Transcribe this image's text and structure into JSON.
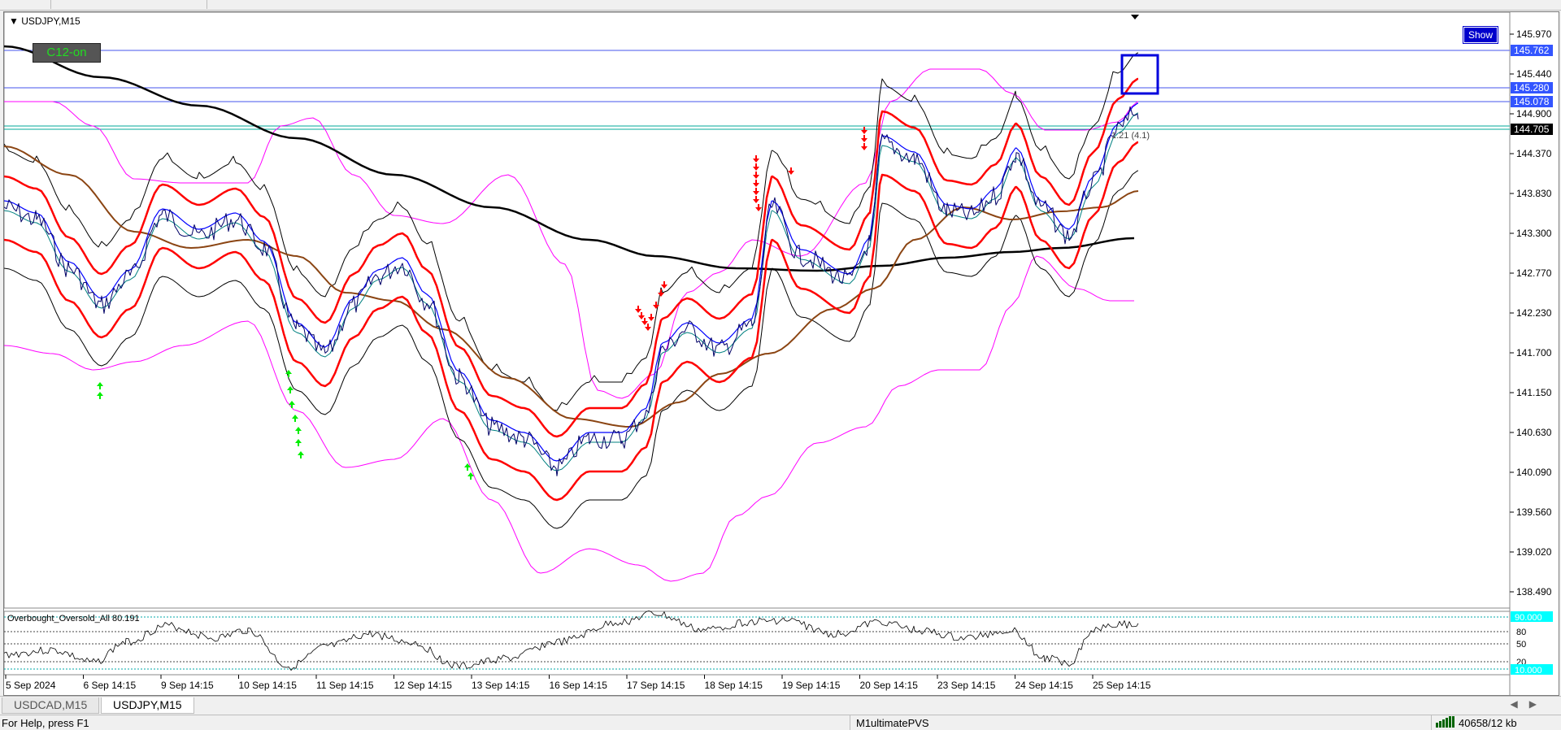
{
  "chart": {
    "symbol_label": "USDJPY,M15",
    "show_button": "Show",
    "c12_label": "C12-on",
    "fib_label": "1.21 (4.1)",
    "price_ticks": [
      "145.970",
      "145.440",
      "144.900",
      "144.370",
      "143.830",
      "143.300",
      "142.770",
      "142.230",
      "141.700",
      "141.150",
      "140.630",
      "140.090",
      "139.560",
      "139.020",
      "138.490"
    ],
    "price_tags": [
      {
        "text": "145.762",
        "bg": "#3355ff",
        "fg": "#ffffff"
      },
      {
        "text": "145.280",
        "bg": "#3355ff",
        "fg": "#ffffff"
      },
      {
        "text": "145.078",
        "bg": "#3355ff",
        "fg": "#ffffff"
      },
      {
        "text": "144.705",
        "bg": "#000000",
        "fg": "#ffffff"
      }
    ],
    "date_ticks": [
      "5 Sep 2024",
      "6 Sep 14:15",
      "9 Sep 14:15",
      "10 Sep 14:15",
      "11 Sep 14:15",
      "12 Sep 14:15",
      "13 Sep 14:15",
      "16 Sep 14:15",
      "17 Sep 14:15",
      "18 Sep 14:15",
      "19 Sep 14:15",
      "20 Sep 14:15",
      "23 Sep 14:15",
      "24 Sep 14:15",
      "25 Sep 14:15"
    ],
    "colors": {
      "candles": "#000066",
      "ma_black": "#000000",
      "ma_brown": "#8b4513",
      "envelope_red": "#ff0000",
      "bands_black": "#000000",
      "bands_magenta": "#ff00ff",
      "ma_blue": "#0000ff",
      "ma_teal": "#008080",
      "horizontal_blue": "#4455ee",
      "horizontal_teal": "#00aa99",
      "arrow_green": "#00ee00",
      "arrow_red": "#ff0000"
    }
  },
  "oscillator": {
    "label": "Overbought_Oversold_All 80.191",
    "levels": [
      "80",
      "50",
      "20"
    ],
    "top_tag": "90.000",
    "bottom_tag": "10.000",
    "tag_bg": "#00ffff"
  },
  "tabs": [
    {
      "label": "USDCAD,M15",
      "active": false
    },
    {
      "label": "USDJPY,M15",
      "active": true
    }
  ],
  "statusbar": {
    "help": "For Help, press F1",
    "profile": "M1ultimatePVS",
    "traffic": "40658/12 kb"
  }
}
